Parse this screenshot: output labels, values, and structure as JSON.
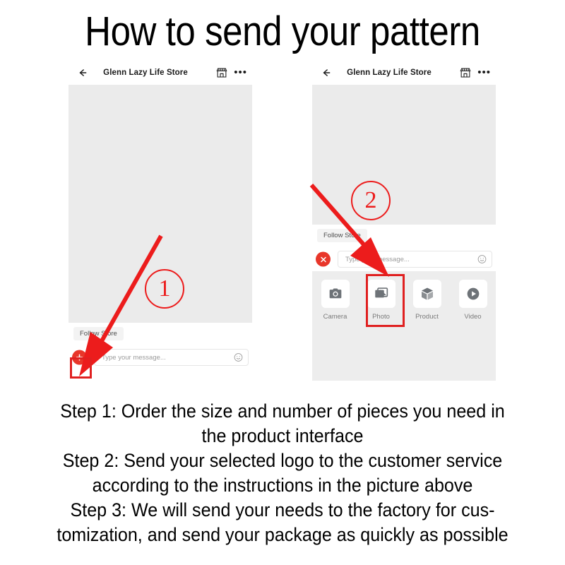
{
  "title": "How to send your pattern",
  "panels": {
    "left": {
      "name": "chat-screen-plus",
      "header": {
        "back_icon": "back-arrow-icon",
        "title": "Glenn Lazy Life Store",
        "store_icon": "store-icon",
        "menu_icon": "more-options-icon"
      },
      "follow_chip": "Follow Store",
      "action_button": {
        "icon": "plus-icon",
        "color": "#e8362a"
      },
      "message_input": {
        "placeholder": "Type your message...",
        "value": ""
      },
      "emoji_icon": "smiley-icon"
    },
    "right": {
      "name": "chat-screen-attachments",
      "header": {
        "back_icon": "back-arrow-icon",
        "title": "Glenn Lazy Life Store",
        "store_icon": "store-icon",
        "menu_icon": "more-options-icon"
      },
      "follow_chip": "Follow Store",
      "action_button": {
        "icon": "close-x-icon",
        "color": "#e8362a"
      },
      "message_input": {
        "placeholder": "Type your message...",
        "value": ""
      },
      "emoji_icon": "smiley-icon",
      "attachments": [
        {
          "icon": "camera-icon",
          "label": "Camera",
          "highlighted": false
        },
        {
          "icon": "photo-icon",
          "label": "Photo",
          "highlighted": true
        },
        {
          "icon": "product-box-icon",
          "label": "Product",
          "highlighted": false
        },
        {
          "icon": "video-play-icon",
          "label": "Video",
          "highlighted": false
        }
      ]
    }
  },
  "annotations": {
    "marker_color": "#ec1c1c",
    "highlight_color": "#e02020",
    "step_1_badge": "1",
    "step_2_badge": "2"
  },
  "steps": {
    "line1": "Step 1: Order the size and number of pieces you need in",
    "line2": "the product interface",
    "line3": "Step 2: Send your selected logo to the customer service",
    "line4": "according to the instructions in the picture above",
    "line5": "Step 3: We will send your needs to the factory for cus-",
    "line6": "tomization, and send your package as quickly as possible"
  }
}
